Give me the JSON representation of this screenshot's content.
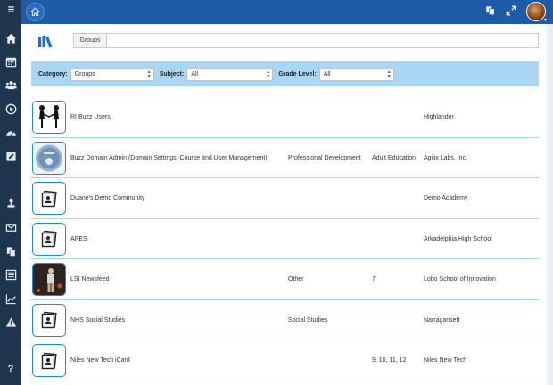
{
  "sidebar": {
    "items": [
      {
        "icon": "menu-icon"
      },
      {
        "icon": "home-icon"
      },
      {
        "icon": "calendar-icon"
      },
      {
        "icon": "users-icon"
      },
      {
        "icon": "play-icon"
      },
      {
        "icon": "dashboard-icon"
      },
      {
        "icon": "edit-icon"
      },
      {
        "icon": "upload-icon"
      },
      {
        "icon": "mail-icon"
      },
      {
        "icon": "files-icon"
      },
      {
        "icon": "list-icon"
      },
      {
        "icon": "chart-icon"
      },
      {
        "icon": "warning-icon"
      },
      {
        "icon": "help-icon"
      }
    ],
    "help_label": "?"
  },
  "topbar": {
    "icons": [
      "home-icon",
      "copy-icon",
      "expand-icon",
      "avatar"
    ]
  },
  "search": {
    "label": "Groups",
    "value": "",
    "placeholder": ""
  },
  "filters": {
    "category_label": "Category:",
    "category_value": "Groups",
    "subject_label": "Subject:",
    "subject_value": "All",
    "grade_label": "Grade Level:",
    "grade_value": "All"
  },
  "rows": [
    {
      "name": "RI Buzz Users",
      "subject": "",
      "grade": "",
      "school": "Highlander",
      "thumb": "handshake-image"
    },
    {
      "name": "Buzz Domain Admin (Domain Settings, Course and User Management)",
      "subject": "Professional Development",
      "grade": "Adult Education",
      "school": "Agilix Labs, Inc.",
      "thumb": "badge-image"
    },
    {
      "name": "Duane's Demo Community",
      "subject": "",
      "grade": "",
      "school": "Demo Academy",
      "thumb": "group-placeholder-icon"
    },
    {
      "name": "APES",
      "subject": "",
      "grade": "",
      "school": "Arkadelphia High School",
      "thumb": "group-placeholder-icon"
    },
    {
      "name": "LSI Newsfeed",
      "subject": "Other",
      "grade": "7",
      "school": "Lobo School of Innovation",
      "thumb": "photo-image"
    },
    {
      "name": "NHS Social Studies",
      "subject": "Social Studies",
      "grade": "",
      "school": "Narragansett",
      "thumb": "group-placeholder-icon"
    },
    {
      "name": "Niles New Tech iCard",
      "subject": "",
      "grade": "9, 10, 11, 12",
      "school": "Niles New Tech",
      "thumb": "group-placeholder-icon"
    }
  ],
  "colors": {
    "topbar": "#1f5aa6",
    "sidebar": "#1e3550",
    "filter_bar": "#a9d6f5",
    "accent": "#1a8ad4"
  }
}
